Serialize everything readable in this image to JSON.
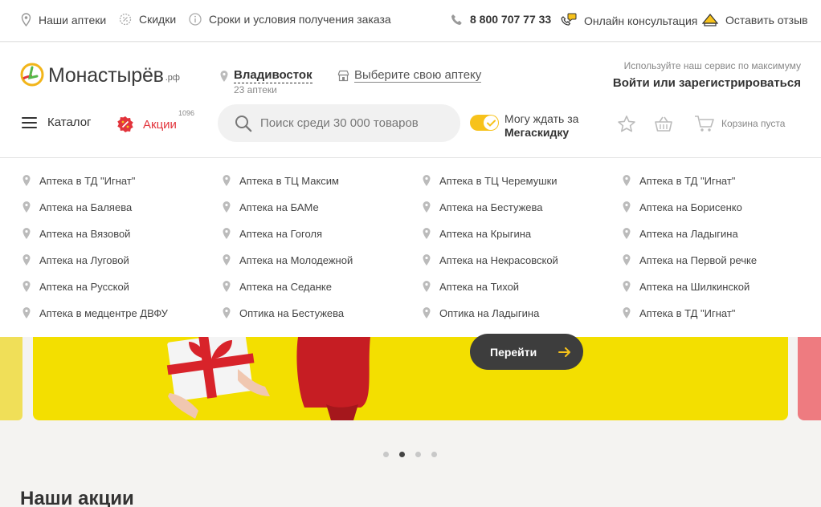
{
  "topbar": {
    "pharmacies": "Наши аптеки",
    "discounts": "Скидки",
    "terms": "Сроки и условия получения заказа",
    "phone": "8 800 707 77 33",
    "consult": "Онлайн консультация",
    "feedback": "Оставить отзыв"
  },
  "logo": {
    "name": "Монастырёв",
    "suffix": ".рф"
  },
  "location": {
    "city": "Владивосток",
    "count": "23 аптеки",
    "choose_pharmacy": "Выберите свою аптеку"
  },
  "auth": {
    "hint": "Используйте наш сервис по максимуму",
    "link": "Войти или зарегистрироваться"
  },
  "nav": {
    "catalog": "Каталог",
    "promo": "Акции",
    "promo_count": "1096"
  },
  "search": {
    "placeholder": "Поиск среди 30 000 товаров"
  },
  "mega": {
    "line1": "Могу ждать за",
    "line2": "Мегаскидку",
    "enabled": true
  },
  "cart": {
    "label": "Корзина пуста"
  },
  "pharmacy_columns": [
    [
      "Аптека в ТД \"Игнат\"",
      "Аптека на Баляева",
      "Аптека на Вязовой",
      "Аптека на Луговой",
      "Аптека на Русской",
      "Аптека в медцентре ДВФУ"
    ],
    [
      "Аптека в ТЦ Максим",
      "Аптека на БАМе",
      "Аптека на Гоголя",
      "Аптека на Молодежной",
      "Аптека на Седанке",
      "Оптика на Бестужева"
    ],
    [
      "Аптека в ТЦ Черемушки",
      "Аптека на Бестужева",
      "Аптека на Крыгина",
      "Аптека на Некрасовской",
      "Аптека на Тихой",
      "Оптика на Ладыгина"
    ],
    [
      "Аптека в ТД \"Игнат\"",
      "Аптека на Борисенко",
      "Аптека на Ладыгина",
      "Аптека на Первой речке",
      "Аптека на Шилкинской",
      "Аптека в ТД \"Игнат\""
    ]
  ],
  "banner": {
    "button": "Перейти",
    "active_slide": 2,
    "slides": 4
  },
  "section": {
    "title": "Наши акции"
  },
  "colors": {
    "accent_yellow": "#f3df00",
    "promo_red": "#e2343c",
    "toggle": "#f7c21b",
    "dark_button": "#3d3d3d"
  },
  "icons": [
    "location-pin-icon",
    "discount-icon",
    "info-icon",
    "phone-icon",
    "chat-icon",
    "feedback-icon",
    "store-icon",
    "search-icon",
    "check-icon",
    "star-icon",
    "basket-icon",
    "cart-icon",
    "arrow-right-icon",
    "promo-badge-icon",
    "menu-icon"
  ]
}
